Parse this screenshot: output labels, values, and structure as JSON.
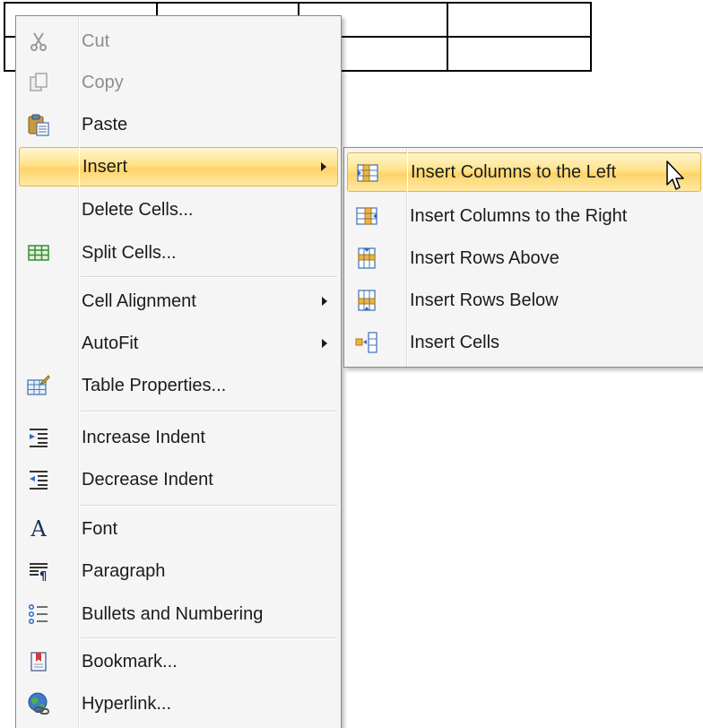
{
  "context_menu": {
    "items": [
      {
        "label": "Cut",
        "icon": "scissors-icon",
        "disabled": true
      },
      {
        "label": "Copy",
        "icon": "copy-icon",
        "disabled": true
      },
      {
        "label": "Paste",
        "icon": "paste-icon",
        "disabled": false
      },
      {
        "label": "Insert",
        "icon": "",
        "has_submenu": true,
        "highlighted": true
      },
      {
        "label": "Delete Cells...",
        "icon": ""
      },
      {
        "label": "Split Cells...",
        "icon": "split-cells-icon"
      },
      {
        "label": "Cell Alignment",
        "icon": "",
        "has_submenu": true
      },
      {
        "label": "AutoFit",
        "icon": "",
        "has_submenu": true
      },
      {
        "label": "Table Properties...",
        "icon": "table-properties-icon"
      },
      {
        "label": "Increase Indent",
        "icon": "increase-indent-icon"
      },
      {
        "label": "Decrease Indent",
        "icon": "decrease-indent-icon"
      },
      {
        "label": "Font",
        "icon": "font-icon"
      },
      {
        "label": "Paragraph",
        "icon": "paragraph-icon"
      },
      {
        "label": "Bullets and Numbering",
        "icon": "bullets-numbering-icon"
      },
      {
        "label": "Bookmark...",
        "icon": "bookmark-icon"
      },
      {
        "label": "Hyperlink...",
        "icon": "hyperlink-icon"
      }
    ]
  },
  "insert_submenu": {
    "items": [
      {
        "label": "Insert Columns to the Left",
        "icon": "insert-columns-left-icon",
        "highlighted": true
      },
      {
        "label": "Insert Columns to the Right",
        "icon": "insert-columns-right-icon"
      },
      {
        "label": "Insert Rows Above",
        "icon": "insert-rows-above-icon"
      },
      {
        "label": "Insert Rows Below",
        "icon": "insert-rows-below-icon"
      },
      {
        "label": "Insert Cells",
        "icon": "insert-cells-icon"
      }
    ]
  },
  "colors": {
    "highlight_gradient_mid": "#fdd36a",
    "menu_background": "#f5f5f5",
    "text": "#1b1b1b",
    "disabled_text": "#8d8d8d"
  }
}
